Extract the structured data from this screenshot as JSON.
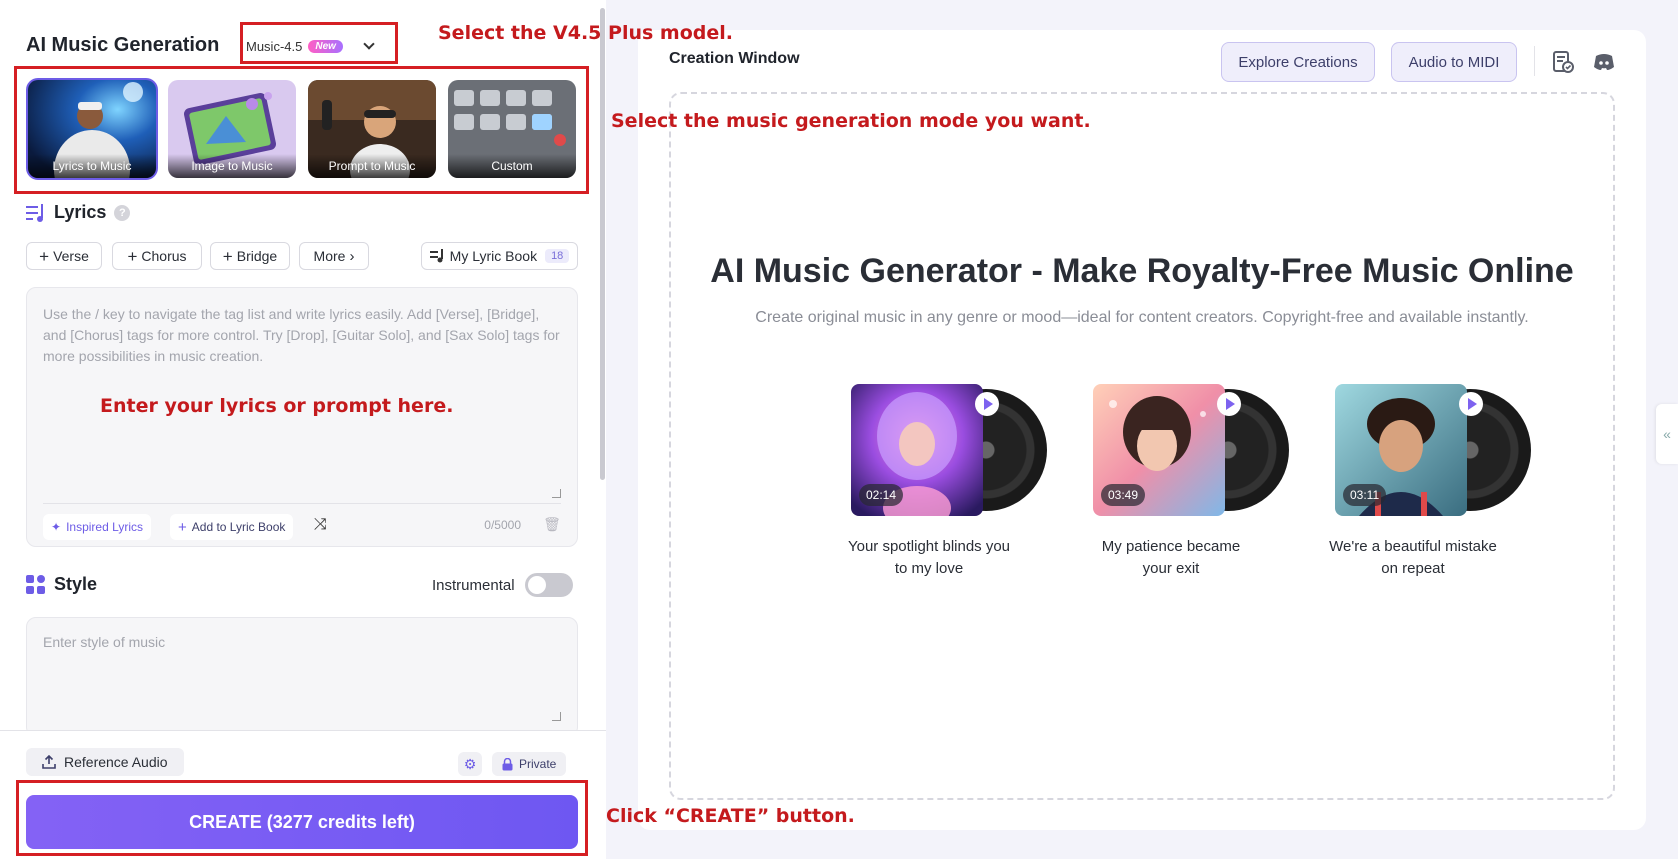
{
  "left": {
    "title": "AI Music Generation",
    "model": {
      "name": "Music-4.5",
      "badge": "New"
    },
    "modes": [
      {
        "label": "Lyrics to Music",
        "active": true
      },
      {
        "label": "Image to Music",
        "active": false
      },
      {
        "label": "Prompt to Music",
        "active": false
      },
      {
        "label": "Custom",
        "active": false
      }
    ],
    "lyrics": {
      "heading": "Lyrics",
      "tags": [
        "Verse",
        "Chorus",
        "Bridge"
      ],
      "more": "More",
      "lyric_book": "My Lyric Book",
      "lyric_book_count": "18",
      "placeholder": "Use the / key to navigate the tag list and write lyrics easily. Add [Verse], [Bridge], and [Chorus] tags for more control. Try [Drop], [Guitar Solo], and [Sax Solo] tags for more possibilities in music creation.",
      "inspired": "Inspired Lyrics",
      "add_to_book": "Add to Lyric Book",
      "count": "0/5000"
    },
    "style": {
      "heading": "Style",
      "instrumental": "Instrumental",
      "placeholder": "Enter style of music"
    },
    "bottom": {
      "reference": "Reference Audio",
      "private": "Private",
      "create": "CREATE (3277 credits left)"
    }
  },
  "right": {
    "window_title": "Creation Window",
    "explore": "Explore Creations",
    "audio_midi": "Audio to MIDI",
    "hero_title": "AI Music Generator - Make Royalty-Free Music Online",
    "hero_sub": "Create original music in any genre or mood—ideal for content creators. Copyright-free and available instantly.",
    "samples": [
      {
        "duration": "02:14",
        "caption": "Your spotlight blinds you to my love"
      },
      {
        "duration": "03:49",
        "caption": "My patience became your exit"
      },
      {
        "duration": "03:11",
        "caption": "We're a beautiful mistake on repeat"
      }
    ]
  },
  "annotations": {
    "model": "Select the V4.5 Plus model.",
    "mode": "Select the music generation mode you want.",
    "lyrics": "Enter your lyrics or prompt here.",
    "create": "Click “CREATE” button."
  },
  "colors": {
    "accent": "#6d5ce6",
    "annotation": "#d51f23"
  }
}
